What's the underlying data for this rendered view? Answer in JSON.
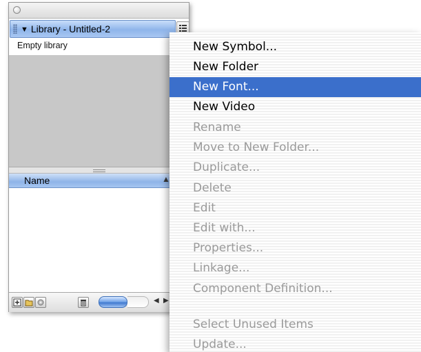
{
  "panel": {
    "title": "Library - Untitled-2",
    "status_text": "Empty library",
    "column_header": "Name",
    "icons": {
      "collapse": "triangle-down-icon",
      "options": "panel-options-icon",
      "sort": "sort-up-arrow-icon",
      "new_symbol": "new-symbol-icon",
      "new_folder": "new-folder-icon",
      "properties": "properties-icon",
      "delete": "trash-icon"
    }
  },
  "menu": {
    "items": [
      {
        "label": "New Symbol...",
        "enabled": true
      },
      {
        "label": "New Folder",
        "enabled": true
      },
      {
        "label": "New Font...",
        "enabled": true,
        "highlighted": true
      },
      {
        "label": "New Video",
        "enabled": true
      },
      {
        "label": "Rename",
        "enabled": false
      },
      {
        "label": "Move to New Folder...",
        "enabled": false
      },
      {
        "label": "Duplicate...",
        "enabled": false
      },
      {
        "label": "Delete",
        "enabled": false
      },
      {
        "label": "Edit",
        "enabled": false
      },
      {
        "label": "Edit with...",
        "enabled": false
      },
      {
        "label": "Properties...",
        "enabled": false
      },
      {
        "label": "Linkage...",
        "enabled": false
      },
      {
        "label": "Component Definition...",
        "enabled": false
      },
      {
        "label": "Select Unused Items",
        "enabled": false
      },
      {
        "label": "Update...",
        "enabled": false
      }
    ],
    "colors": {
      "highlight": "#3b6fcb",
      "disabled_text": "#9a9a9a"
    }
  }
}
